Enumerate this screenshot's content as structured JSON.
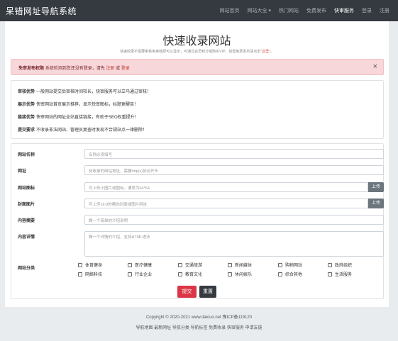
{
  "header": {
    "brand": "呆错网址导航系统",
    "nav": [
      "网站首页",
      "网站大全 ▾",
      "热门网站",
      "免费发布",
      "快审服务",
      "登录",
      "注册"
    ],
    "active_index": 4
  },
  "page": {
    "title": "快速收录网站",
    "subtitle_before": "快速收录不需要审核免审核即可以显示，可通过会员积分或购买VIP，如需免费发布请点击",
    "subtitle_link": "\"这里\"",
    "subtitle_after": "。"
  },
  "alert": {
    "bold": "免审发布权限",
    "text": "系统检测到您还没有登录，请先",
    "register": "注册",
    "or": "或",
    "login": "登录",
    "close": "×"
  },
  "benefits": [
    {
      "label": "审核优势",
      "text": "一般网站提交后审核时间较长，快审服务可以立马通过审核！"
    },
    {
      "label": "展示优势",
      "text": "快审网站首页展示推荐，显示快审图标，标题更醒目！"
    },
    {
      "label": "链接优势",
      "text": "快审网站的网址全站直接链接，有助于SEO权重提升！"
    },
    {
      "label": "提交要求",
      "text": "不收录非法网站、管理员复查时发现不合规站点一律删除！"
    }
  ],
  "form": {
    "name": {
      "label": "网站名称",
      "placeholder": "名称必须填写"
    },
    "url": {
      "label": "网址",
      "placeholder": "待收录的网站地址，需要http(s)协议开头"
    },
    "icon": {
      "label": "网站图标",
      "placeholder": "可上传小图片或图标，通常为64*64",
      "button": "上传"
    },
    "cover": {
      "label": "封面图片",
      "placeholder": "可上传16:9的横向封面或图片网址",
      "button": "上传"
    },
    "summary": {
      "label": "内容摘要",
      "placeholder": "做一个简单的介绍说明"
    },
    "detail": {
      "label": "内容详情",
      "placeholder": "做一个详情的介绍，支持HTML语法"
    },
    "category": {
      "label": "网站分类",
      "options": [
        "体育健身",
        "医疗健康",
        "交通旅游",
        "新闻媒体",
        "购物网站",
        "政府组织",
        "网络科技",
        "行业企业",
        "教育文化",
        "休闲娱乐",
        "综合其他",
        "生活服务"
      ]
    },
    "submit": "提交",
    "reset": "重置"
  },
  "footer": {
    "copyright": "Copyright © 2020-2021 www.daicuo.net 豫ICP备119120",
    "links": "导航地图 最新网址 导航分类 导航标签 免费收录 快审服务 申请友链"
  }
}
